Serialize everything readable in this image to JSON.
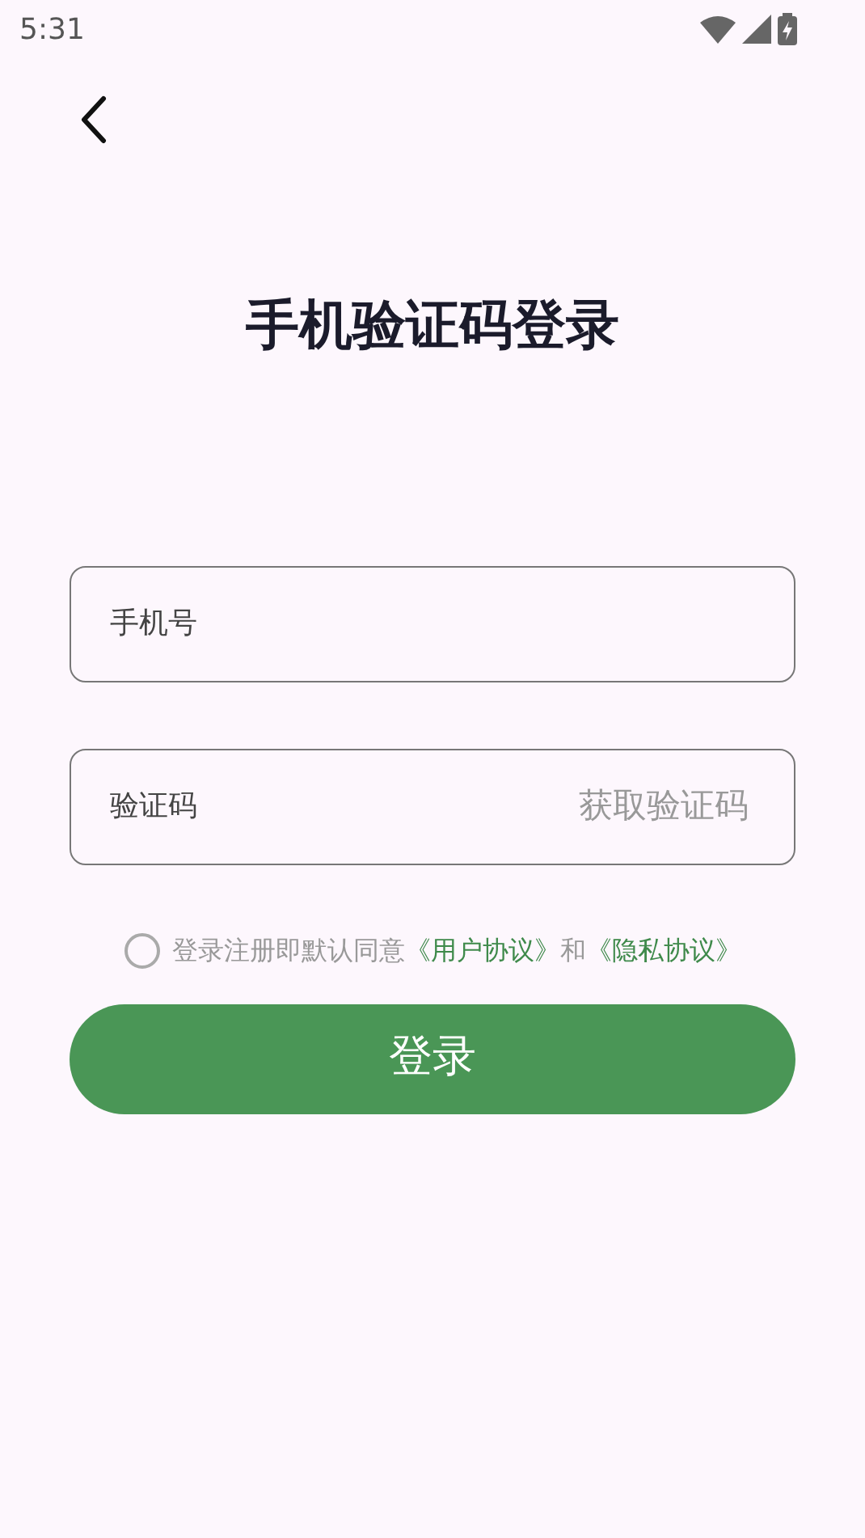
{
  "status_bar": {
    "time": "5:31"
  },
  "title": "手机验证码登录",
  "phone_field": {
    "placeholder": "手机号"
  },
  "code_field": {
    "placeholder": "验证码",
    "action": "获取验证码"
  },
  "agreement": {
    "checked": false,
    "text": "登录注册即默认同意",
    "link_1": "《用户协议》",
    "joiner": "和",
    "link_2": "《隐私协议》"
  },
  "login_button": "登录"
}
